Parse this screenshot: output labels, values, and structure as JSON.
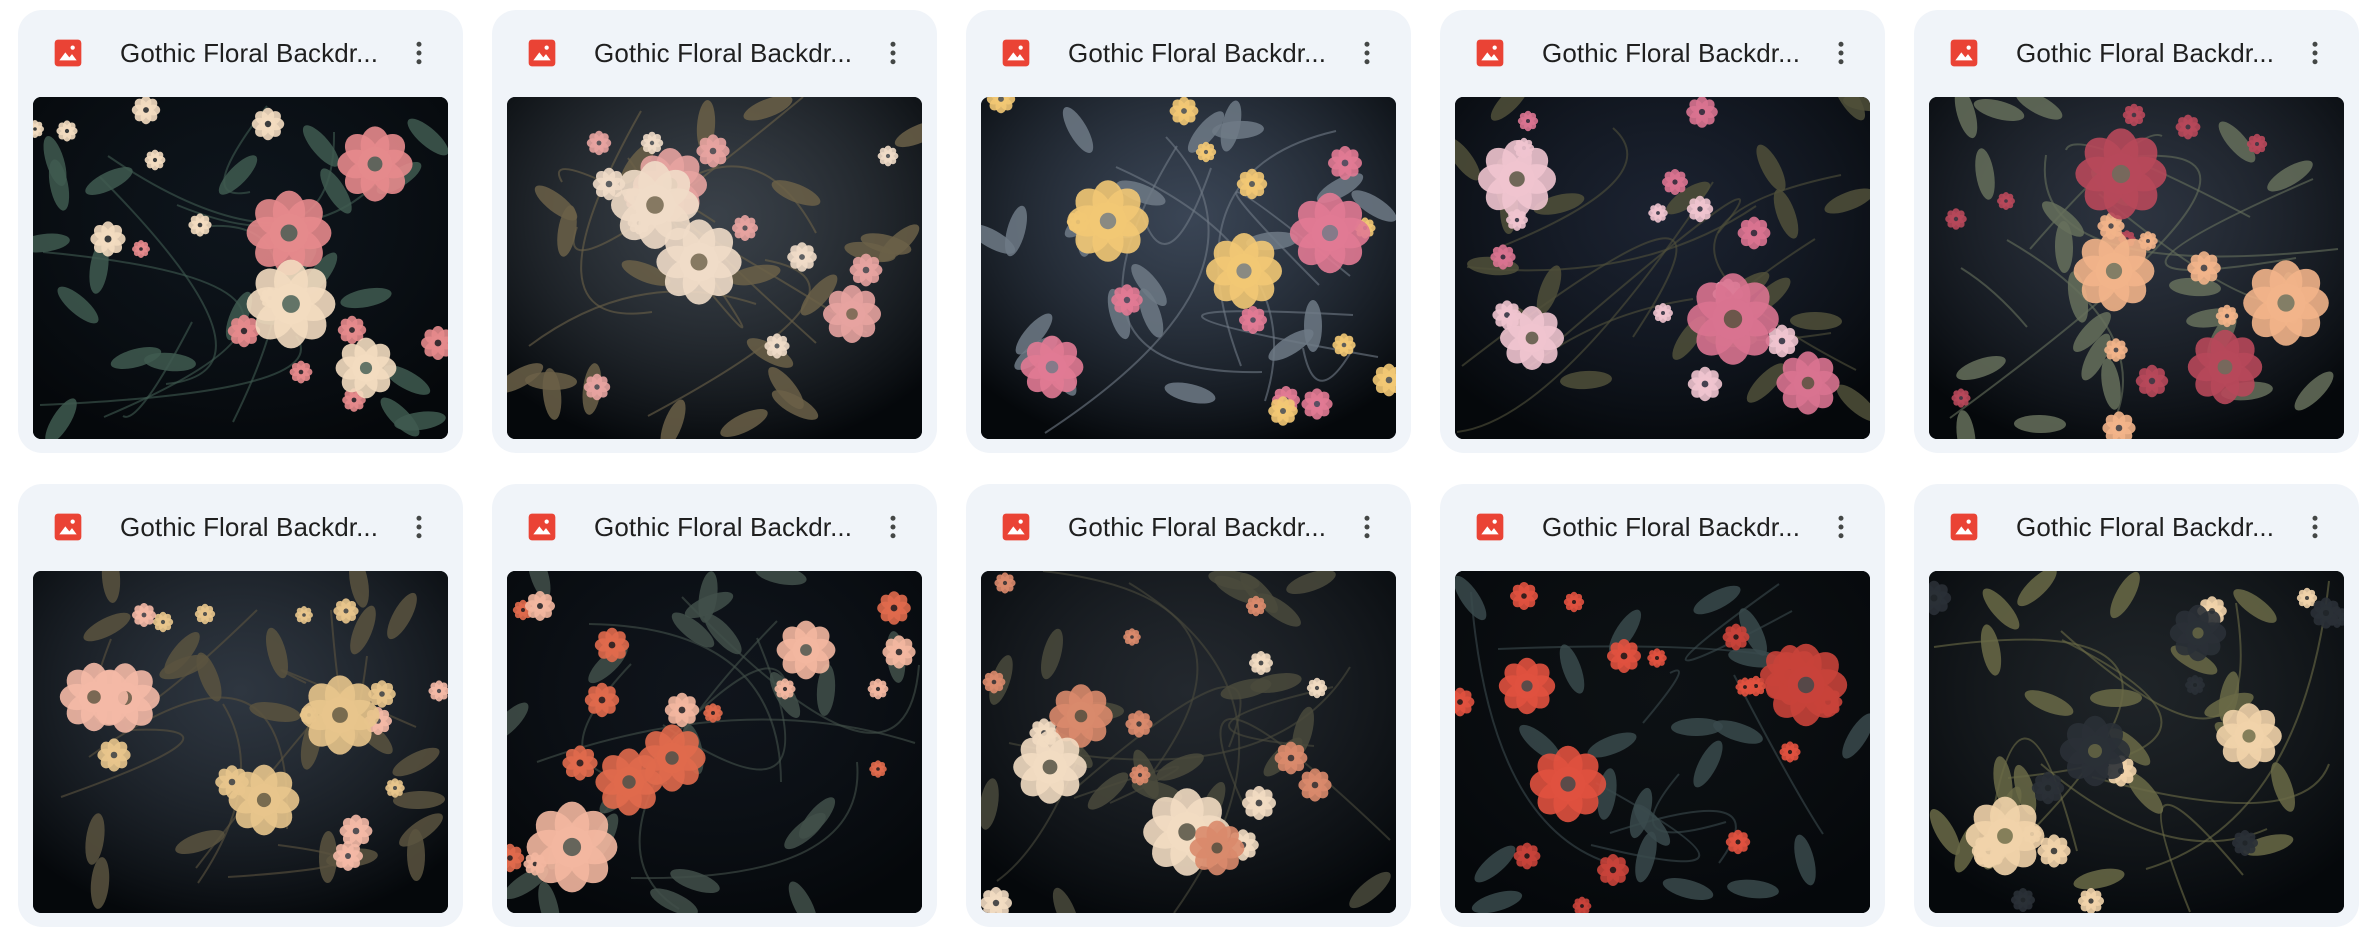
{
  "files": [
    {
      "name": "Gothic Floral Backdr...",
      "icon": "image-file-icon",
      "menu_icon": "more-vert-icon",
      "palette": {
        "bg": "#0e151c",
        "accent": "#e58a8c",
        "accent2": "#f3dcc0",
        "leaf": "#3f5a50"
      }
    },
    {
      "name": "Gothic Floral Backdr...",
      "icon": "image-file-icon",
      "menu_icon": "more-vert-icon",
      "palette": {
        "bg": "#3a4149",
        "accent": "#e7a3a0",
        "accent2": "#f0dcc8",
        "leaf": "#6b6048"
      }
    },
    {
      "name": "Gothic Floral Backdr...",
      "icon": "image-file-icon",
      "menu_icon": "more-vert-icon",
      "palette": {
        "bg": "#3a4555",
        "accent": "#e17a94",
        "accent2": "#f2c874",
        "leaf": "#6f7a86"
      }
    },
    {
      "name": "Gothic Floral Backdr...",
      "icon": "image-file-icon",
      "menu_icon": "more-vert-icon",
      "palette": {
        "bg": "#1b2230",
        "accent": "#d97390",
        "accent2": "#f0c4cf",
        "leaf": "#50503a"
      }
    },
    {
      "name": "Gothic Floral Backdr...",
      "icon": "image-file-icon",
      "menu_icon": "more-vert-icon",
      "palette": {
        "bg": "#2d3440",
        "accent": "#f2b48a",
        "accent2": "#b7485a",
        "leaf": "#66705c"
      }
    },
    {
      "name": "Gothic Floral Backdr...",
      "icon": "image-file-icon",
      "menu_icon": "more-vert-icon",
      "palette": {
        "bg": "#2e3640",
        "accent": "#f4b9a6",
        "accent2": "#e8c58c",
        "leaf": "#5b5440"
      }
    },
    {
      "name": "Gothic Floral Backdr...",
      "icon": "image-file-icon",
      "menu_icon": "more-vert-icon",
      "palette": {
        "bg": "#10151c",
        "accent": "#f3b7a0",
        "accent2": "#e06a4c",
        "leaf": "#42504a"
      }
    },
    {
      "name": "Gothic Floral Backdr...",
      "icon": "image-file-icon",
      "menu_icon": "more-vert-icon",
      "palette": {
        "bg": "#23282e",
        "accent": "#f2dcc2",
        "accent2": "#d98a6c",
        "leaf": "#4a4a3c"
      }
    },
    {
      "name": "Gothic Floral Backdr...",
      "icon": "image-file-icon",
      "menu_icon": "more-vert-icon",
      "palette": {
        "bg": "#0d1114",
        "accent": "#e0513f",
        "accent2": "#c8423a",
        "leaf": "#3a4a4c"
      }
    },
    {
      "name": "Gothic Floral Backdr...",
      "icon": "image-file-icon",
      "menu_icon": "more-vert-icon",
      "palette": {
        "bg": "#1f2428",
        "accent": "#f1d3aa",
        "accent2": "#2a3036",
        "leaf": "#6a6a46"
      }
    }
  ],
  "colors": {
    "card_bg": "#f0f4f9",
    "icon_red": "#ea4335",
    "text": "#1f1f1f",
    "menu_dots": "#444746"
  }
}
